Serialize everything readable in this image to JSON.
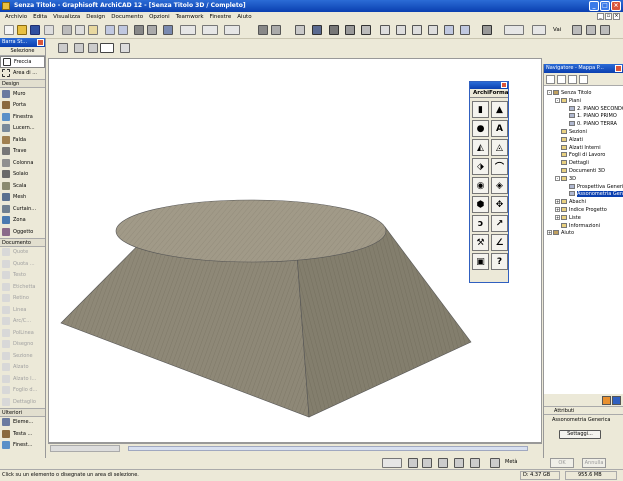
{
  "titlebar": {
    "title": "Senza Titolo - Graphisoft ArchiCAD 12 - [Senza Titolo 3D / Completo]"
  },
  "menubar": {
    "items": [
      "Archivio",
      "Edita",
      "Visualizza",
      "Design",
      "Documento",
      "Opzioni",
      "Teamwork",
      "Finestre",
      "Aiuto"
    ]
  },
  "toolbar1": {
    "goto_label": "Vai"
  },
  "toolbox": {
    "title": "Barra St...",
    "selection_label": "Selezione",
    "arrow": "Freccia",
    "marquee": "Area di ...",
    "design_group": "Design",
    "design_tools": [
      "Muro",
      "Porta",
      "Finestra",
      "Lucern...",
      "Falda",
      "Trave",
      "Colonna",
      "Solaio",
      "Scala",
      "Mesh",
      "Curtain...",
      "Zona",
      "Oggetto"
    ],
    "documento_group": "Documento",
    "documento_tools": [
      "Quote",
      "Quota ...",
      "Testo",
      "Etichetta",
      "Retino",
      "Linea",
      "Arc/C...",
      "PolLinea",
      "Disegno",
      "Sezione",
      "Alzato",
      "Alzato I...",
      "Foglio d...",
      "Dettaglio"
    ],
    "ulteriori_group": "Ulteriori",
    "ulteriori_tools": [
      "Eleme...",
      "Testa ...",
      "Finest..."
    ]
  },
  "archiforma": {
    "title": "ArchiForma"
  },
  "navigator": {
    "title": "Navigatore - Mappa P...",
    "tree": [
      {
        "label": "Senza Titolo",
        "level": 0,
        "toggle": "-"
      },
      {
        "label": "Piani",
        "level": 1,
        "toggle": "-"
      },
      {
        "label": "2. PIANO SECONDO",
        "level": 2,
        "toggle": ""
      },
      {
        "label": "1. PIANO PRIMO",
        "level": 2,
        "toggle": ""
      },
      {
        "label": "0. PIANO TERRA",
        "level": 2,
        "toggle": ""
      },
      {
        "label": "Sezioni",
        "level": 1,
        "toggle": ""
      },
      {
        "label": "Alzati",
        "level": 1,
        "toggle": ""
      },
      {
        "label": "Alzati Interni",
        "level": 1,
        "toggle": ""
      },
      {
        "label": "Fogli di Lavoro",
        "level": 1,
        "toggle": ""
      },
      {
        "label": "Dettagli",
        "level": 1,
        "toggle": ""
      },
      {
        "label": "Documenti 3D",
        "level": 1,
        "toggle": ""
      },
      {
        "label": "3D",
        "level": 1,
        "toggle": "-"
      },
      {
        "label": "Prospettiva Generica",
        "level": 2,
        "toggle": ""
      },
      {
        "label": "Assonometria Generica",
        "level": 2,
        "toggle": "",
        "selected": true
      },
      {
        "label": "Abachi",
        "level": 1,
        "toggle": "+"
      },
      {
        "label": "Indice Progetto",
        "level": 1,
        "toggle": "+"
      },
      {
        "label": "Liste",
        "level": 1,
        "toggle": "+"
      },
      {
        "label": "Informazioni",
        "level": 1,
        "toggle": ""
      },
      {
        "label": "Aiuto",
        "level": 0,
        "toggle": "+"
      }
    ]
  },
  "attributes": {
    "title": "Attributi",
    "value": "Assonometria Generica",
    "settings_button": "Settaggi...",
    "ok_button": "OK",
    "cancel_button": "Annulla"
  },
  "bottom_toolbar": {
    "label": "Metà"
  },
  "statusbar": {
    "message": "Click su un elemento o disegnate un area di selezione.",
    "disk": "D: 4.37 GB",
    "memory": "955.6 MB"
  },
  "colors": {
    "titlebar": "#0a3fb0",
    "model_fill": "#8e8877",
    "model_top": "#a19a88"
  }
}
